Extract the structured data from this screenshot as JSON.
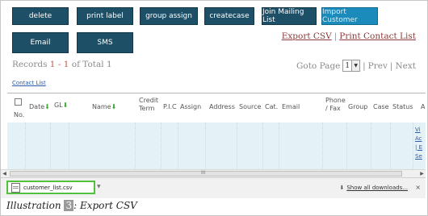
{
  "toolbar": {
    "row1": [
      {
        "label": "delete",
        "name": "delete-button"
      },
      {
        "label": "print label",
        "name": "print-label-button"
      },
      {
        "label": "group assign",
        "name": "group-assign-button"
      },
      {
        "label": "createcase",
        "name": "createcase-button"
      },
      {
        "label": "Join Mailing List",
        "name": "join-mailing-list-button"
      },
      {
        "label": "Import Customer",
        "name": "import-customer-button"
      }
    ],
    "row2": [
      {
        "label": "Email",
        "name": "email-button"
      },
      {
        "label": "SMS",
        "name": "sms-button"
      }
    ]
  },
  "toplinks": {
    "export_csv": "Export CSV",
    "separator": "|",
    "print_contact_list": "Print Contact List"
  },
  "records": {
    "prefix": "Records ",
    "start": "1",
    "dash": " - ",
    "end": "1",
    "of": " of Total ",
    "total": "1"
  },
  "pager": {
    "goto_label": "Goto Page",
    "page": "1",
    "sep1": "|",
    "prev": "Prev",
    "sep2": "|",
    "next": "Next"
  },
  "contact_list_label": "Contact List",
  "table": {
    "no": "No.",
    "date": "Date",
    "gl": "GL",
    "name": "Name",
    "credit_term_1": "Credit",
    "credit_term_2": "Term",
    "pic": "P.I.C",
    "assign": "Assign",
    "address": "Address",
    "source": "Source",
    "cat": "Cat.",
    "email": "Email",
    "phone_1": "Phone",
    "phone_2": "/ Fax",
    "group": "Group",
    "case": "Case",
    "status": "Status",
    "action_partial": "A"
  },
  "row_links": [
    "Vi",
    "Ac",
    "| E",
    "Se"
  ],
  "scrollbar": {
    "grip": "III"
  },
  "download": {
    "file_name": "customer_list.csv",
    "show_all": "Show all downloads...",
    "close": "×"
  },
  "caption": {
    "prefix": "Illustration ",
    "number": "3",
    "suffix": ": Export CSV"
  },
  "colors": {
    "button": "#1d4f66",
    "button_active": "#1a8bbb",
    "download_highlight": "#52c13c",
    "grid_bg": "#e4f1f7",
    "sort_arrow": "#3aaa35"
  }
}
